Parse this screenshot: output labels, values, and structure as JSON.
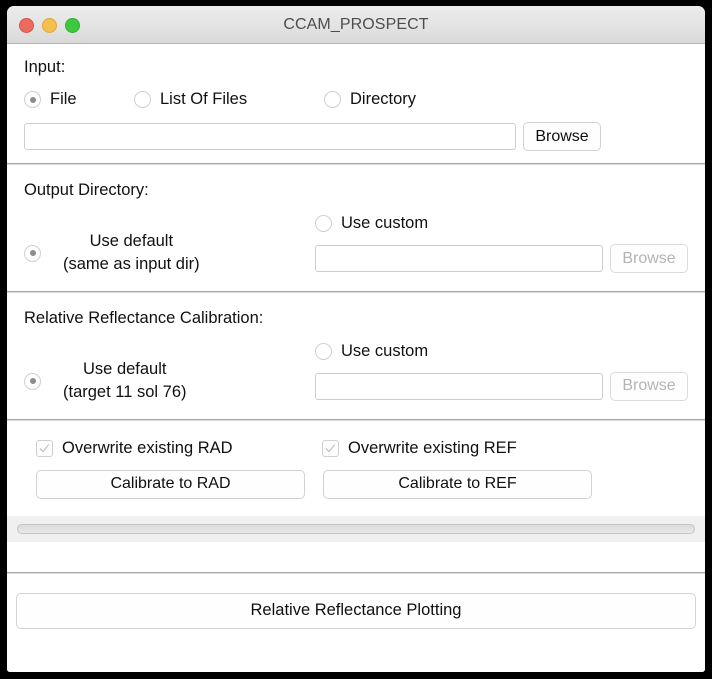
{
  "window": {
    "title": "CCAM_PROSPECT",
    "traffic_lights": [
      {
        "name": "close",
        "color": "#ED6A5E"
      },
      {
        "name": "minimize",
        "color": "#F5BF4F"
      },
      {
        "name": "maximize",
        "color": "#3CC93D"
      }
    ]
  },
  "input_section": {
    "label": "Input:",
    "options": [
      {
        "label": "File",
        "selected": true
      },
      {
        "label": "List Of Files",
        "selected": false
      },
      {
        "label": "Directory",
        "selected": false
      }
    ],
    "path_value": "",
    "path_placeholder": "",
    "browse_label": "Browse"
  },
  "output_section": {
    "label": "Output Directory:",
    "default_option": {
      "line1": "Use default",
      "line2": "(same as input dir)",
      "selected": true
    },
    "custom_option": {
      "label": "Use custom",
      "selected": false
    },
    "custom_path_value": "",
    "custom_path_placeholder": "",
    "browse_label": "Browse",
    "browse_disabled": true
  },
  "calibration_section": {
    "label": "Relative Reflectance Calibration:",
    "default_option": {
      "line1": "Use default",
      "line2": "(target 11 sol 76)",
      "selected": true
    },
    "custom_option": {
      "label": "Use custom",
      "selected": false
    },
    "custom_path_value": "",
    "custom_path_placeholder": "",
    "browse_label": "Browse",
    "browse_disabled": true
  },
  "actions_section": {
    "checkbox_rad": {
      "label": "Overwrite existing RAD",
      "checked": true
    },
    "checkbox_ref": {
      "label": "Overwrite existing REF",
      "checked": true
    },
    "button_rad": "Calibrate to RAD",
    "button_ref": "Calibrate to REF",
    "progress_percent": 0
  },
  "footer_section": {
    "plot_button": "Relative Reflectance Plotting"
  }
}
